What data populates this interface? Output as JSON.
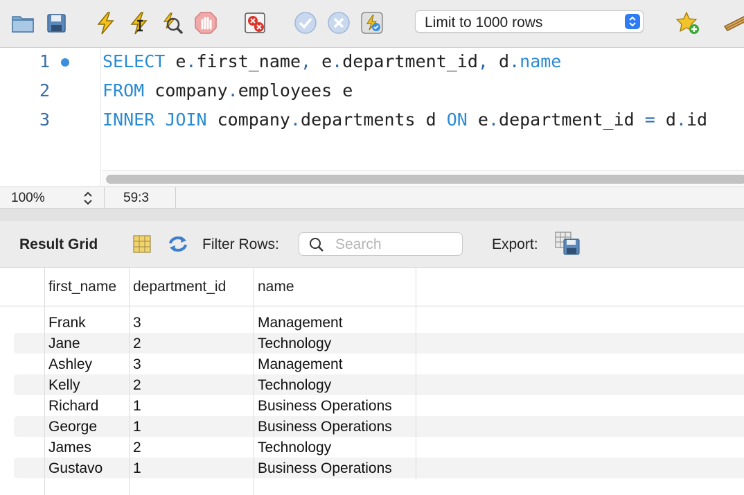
{
  "toolbar": {
    "icons": [
      "open-folder-icon",
      "save-icon",
      "execute-icon",
      "execute-current-icon",
      "explain-icon",
      "stop-icon",
      "toggle-error-icon",
      "commit-icon",
      "rollback-icon",
      "autocommit-icon",
      "add-snippet-icon",
      "beautify-icon"
    ],
    "limit_select": "Limit to 1000 rows"
  },
  "editor": {
    "lines": [
      {
        "number": "1",
        "has_marker": true
      },
      {
        "number": "2",
        "has_marker": false
      },
      {
        "number": "3",
        "has_marker": false
      }
    ],
    "code": [
      [
        {
          "t": "SELECT",
          "k": "kw"
        },
        {
          "t": " e"
        },
        {
          "t": ".",
          "k": "op"
        },
        {
          "t": "first_name"
        },
        {
          "t": ",",
          "k": "op"
        },
        {
          "t": " e"
        },
        {
          "t": ".",
          "k": "op"
        },
        {
          "t": "department_id"
        },
        {
          "t": ",",
          "k": "op"
        },
        {
          "t": " d"
        },
        {
          "t": ".",
          "k": "op"
        },
        {
          "t": "name",
          "k": "kw"
        }
      ],
      [
        {
          "t": "FROM",
          "k": "kw"
        },
        {
          "t": " company"
        },
        {
          "t": ".",
          "k": "op"
        },
        {
          "t": "employees e"
        }
      ],
      [
        {
          "t": "INNER",
          "k": "kw"
        },
        {
          "t": " "
        },
        {
          "t": "JOIN",
          "k": "kw"
        },
        {
          "t": " company"
        },
        {
          "t": ".",
          "k": "op"
        },
        {
          "t": "departments d "
        },
        {
          "t": "ON",
          "k": "kw"
        },
        {
          "t": " e"
        },
        {
          "t": ".",
          "k": "op"
        },
        {
          "t": "department_id "
        },
        {
          "t": "=",
          "k": "op"
        },
        {
          "t": " d"
        },
        {
          "t": ".",
          "k": "op"
        },
        {
          "t": "id"
        }
      ]
    ]
  },
  "status": {
    "zoom": "100%",
    "cursor": "59:3"
  },
  "result_toolbar": {
    "title": "Result Grid",
    "filter_label": "Filter Rows:",
    "search_placeholder": "Search",
    "export_label": "Export:"
  },
  "grid": {
    "columns": [
      "first_name",
      "department_id",
      "name"
    ],
    "rows": [
      [
        "Frank",
        "3",
        "Management"
      ],
      [
        "Jane",
        "2",
        "Technology"
      ],
      [
        "Ashley",
        "3",
        "Management"
      ],
      [
        "Kelly",
        "2",
        "Technology"
      ],
      [
        "Richard",
        "1",
        "Business Operations"
      ],
      [
        "George",
        "1",
        "Business Operations"
      ],
      [
        "James",
        "2",
        "Technology"
      ],
      [
        "Gustavo",
        "1",
        "Business Operations"
      ]
    ]
  },
  "colors": {
    "keyword": "#2a8bd4",
    "line_number": "#3a6ea5",
    "accent": "#2d7bf5"
  }
}
